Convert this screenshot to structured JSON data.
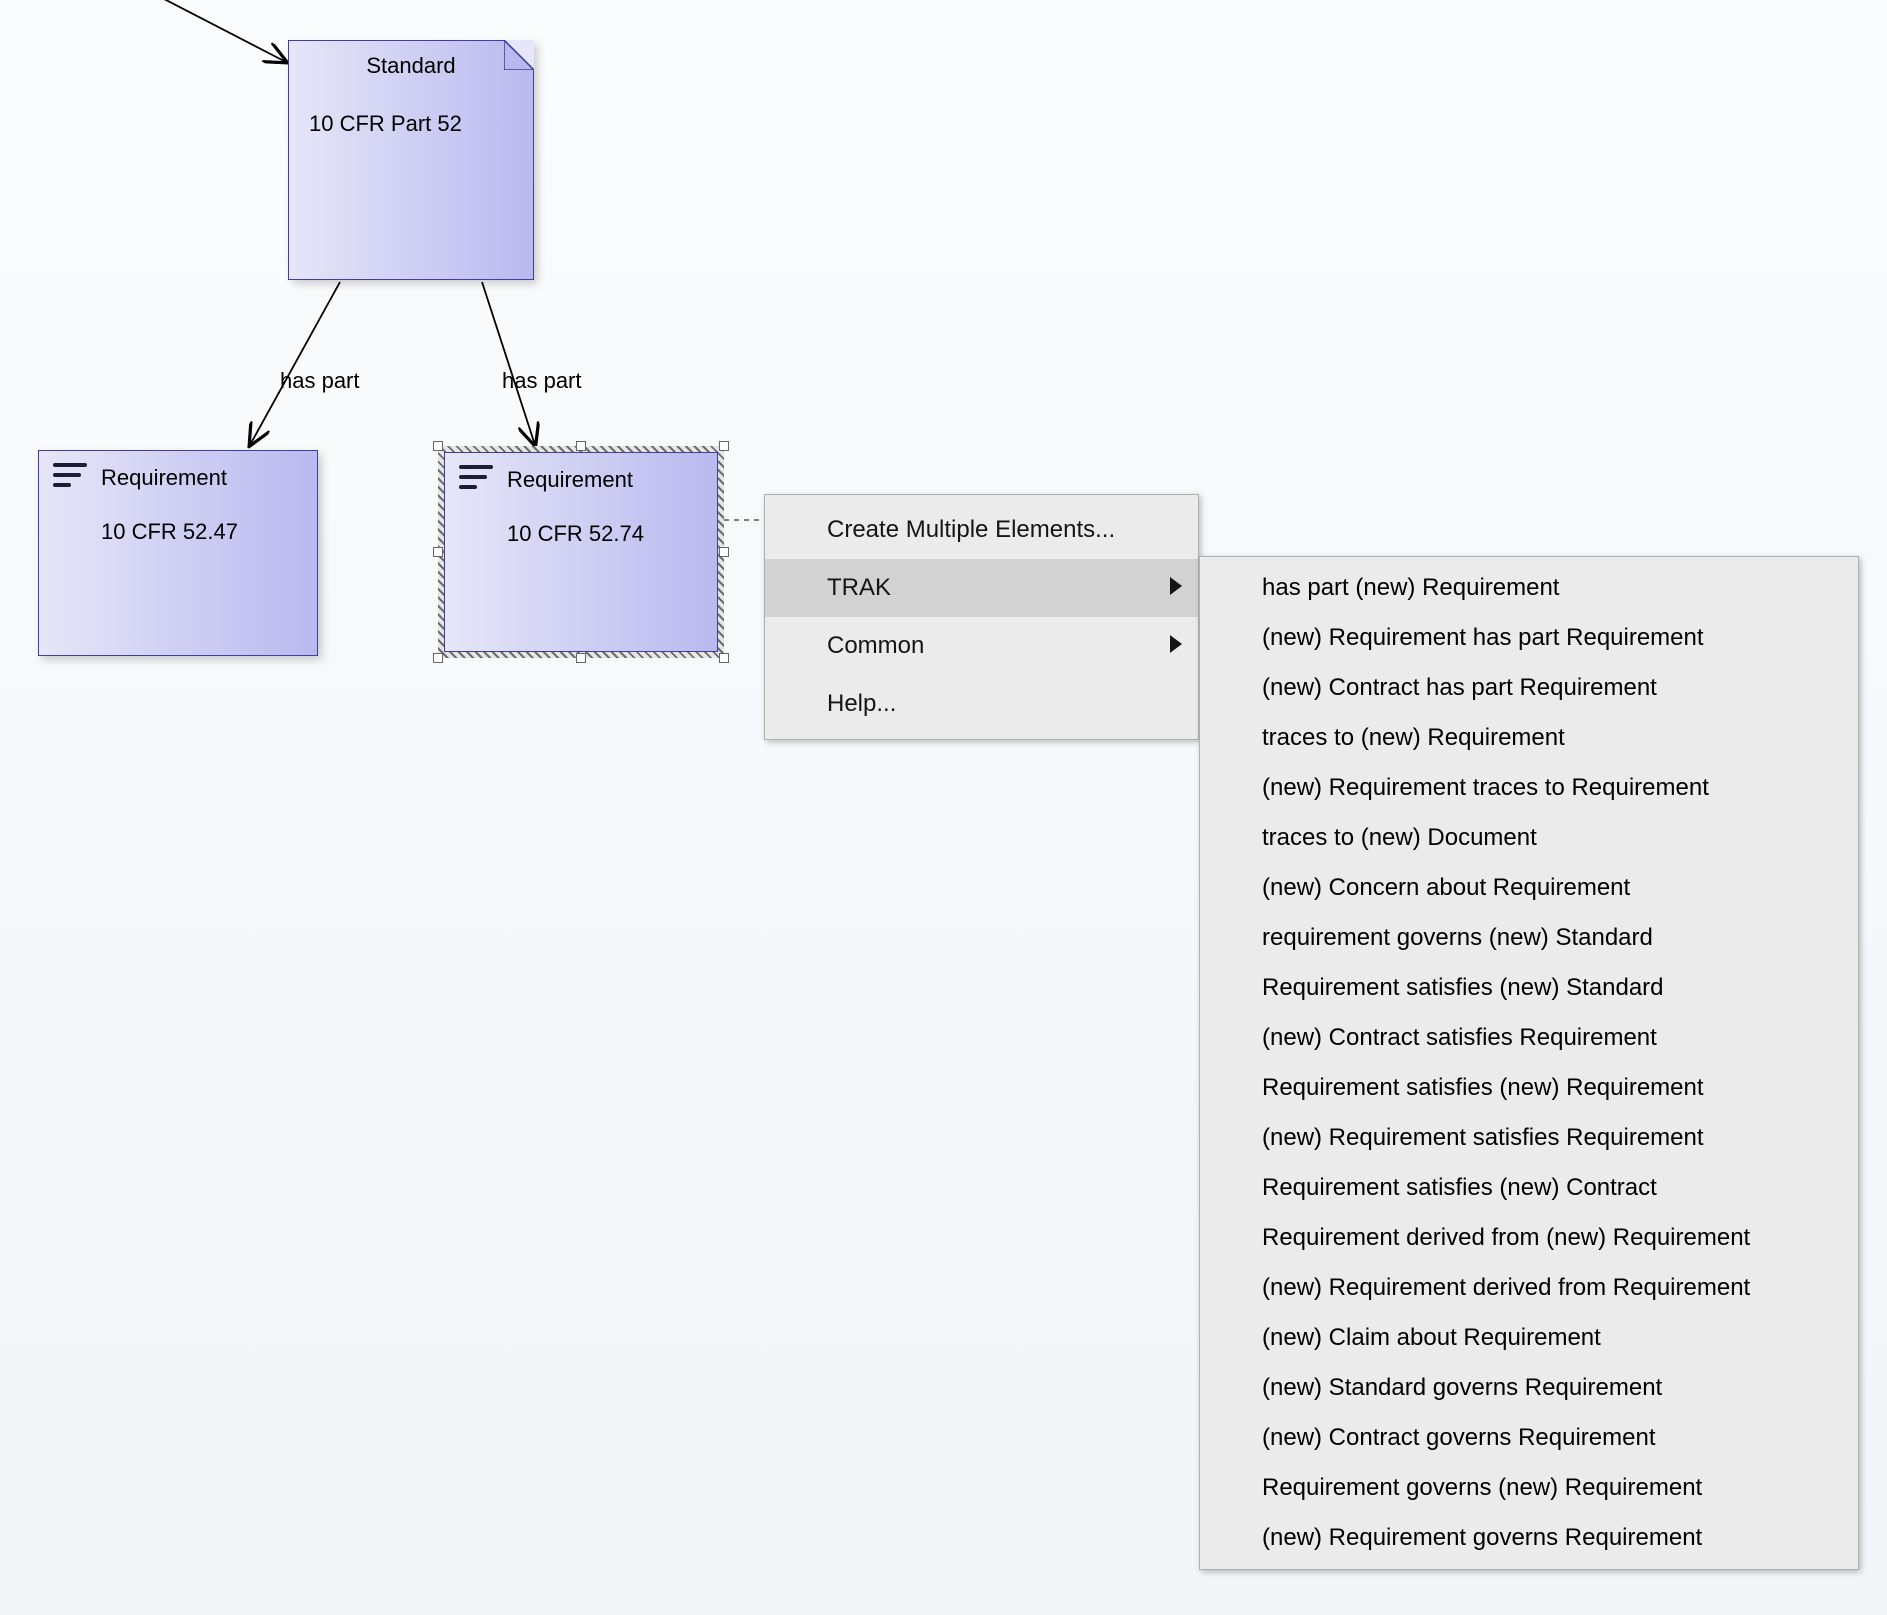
{
  "standard_node": {
    "stereotype": "Standard",
    "name": "10 CFR Part 52"
  },
  "requirement_left": {
    "stereotype": "Requirement",
    "name": "10 CFR 52.47"
  },
  "requirement_right": {
    "stereotype": "Requirement",
    "name": "10 CFR 52.74"
  },
  "connectors": {
    "label_left": "has part",
    "label_right": "has part"
  },
  "context_menu": {
    "items": [
      {
        "label": "Create Multiple Elements...",
        "has_submenu": false
      },
      {
        "label": "TRAK",
        "has_submenu": true,
        "highlighted": true
      },
      {
        "label": "Common",
        "has_submenu": true
      },
      {
        "label": "Help...",
        "has_submenu": false
      }
    ]
  },
  "submenu_trak": [
    "has part (new) Requirement",
    "(new) Requirement has part Requirement",
    "(new) Contract has part Requirement",
    "traces to (new) Requirement",
    "(new) Requirement traces to Requirement",
    "traces to (new) Document",
    "(new) Concern about Requirement",
    "requirement governs (new) Standard",
    "Requirement satisfies (new) Standard",
    "(new) Contract satisfies Requirement",
    "Requirement satisfies (new) Requirement",
    "(new) Requirement satisfies Requirement",
    "Requirement satisfies (new) Contract",
    "Requirement derived from (new) Requirement",
    "(new) Requirement derived from Requirement",
    "(new) Claim about Requirement",
    "(new) Standard governs Requirement",
    "(new) Contract governs Requirement",
    "Requirement governs (new) Requirement",
    "(new) Requirement governs Requirement"
  ]
}
